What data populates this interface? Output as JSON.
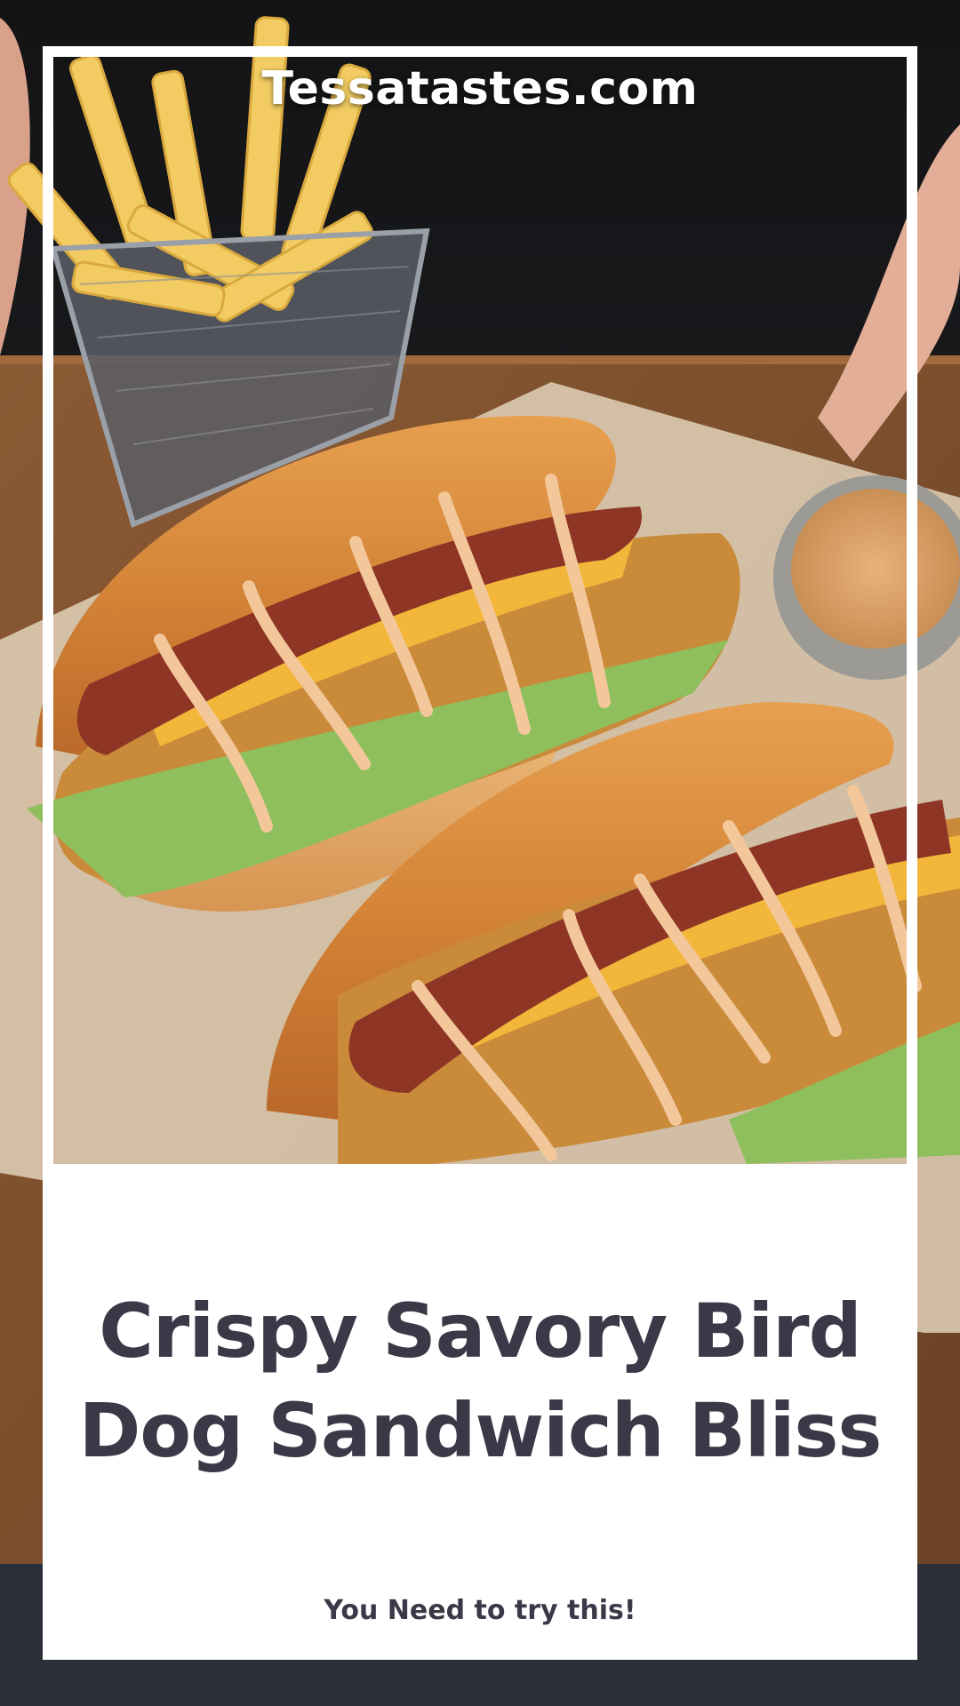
{
  "site": {
    "name": "Tessatastes.com"
  },
  "pin": {
    "title": "Crispy Savory Bird Dog Sandwich Bliss",
    "subtitle": "You Need to try this!"
  },
  "photo": {
    "subject": "two crispy chicken sandwiches with bacon, cheese and sauce, fries basket and dipping sauce bowl"
  },
  "colors": {
    "title_text": "#3a3947",
    "card_background": "#ffffff",
    "frame": "#ffffff"
  }
}
